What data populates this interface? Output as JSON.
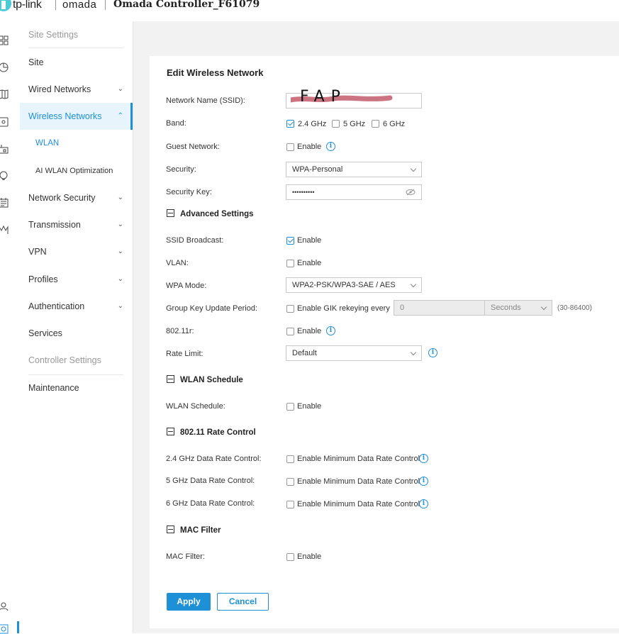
{
  "header": {
    "brand": "tp-link",
    "product": "omada",
    "controller_title": "Omada Controller_F61079"
  },
  "sidebar": {
    "site_settings_header": "Site Settings",
    "items": [
      {
        "label": "Site"
      },
      {
        "label": "Wired Networks"
      },
      {
        "label": "Wireless Networks"
      },
      {
        "label": "WLAN"
      },
      {
        "label": "AI WLAN Optimization"
      },
      {
        "label": "Network Security"
      },
      {
        "label": "Transmission"
      },
      {
        "label": "VPN"
      },
      {
        "label": "Profiles"
      },
      {
        "label": "Authentication"
      },
      {
        "label": "Services"
      }
    ],
    "controller_settings_header": "Controller Settings",
    "maintenance": "Maintenance"
  },
  "form": {
    "title": "Edit Wireless Network",
    "ssid_label": "Network Name (SSID):",
    "ssid_handwritten": "FAP",
    "band_label": "Band:",
    "band_24": "2.4 GHz",
    "band_5": "5 GHz",
    "band_6": "6 GHz",
    "guest_label": "Guest Network:",
    "enable": "Enable",
    "security_label": "Security:",
    "security_value": "WPA-Personal",
    "security_key_label": "Security Key:",
    "security_key_value": "••••••••••",
    "advanced_section": "Advanced Settings",
    "ssid_broadcast_label": "SSID Broadcast:",
    "vlan_label": "VLAN:",
    "wpa_mode_label": "WPA Mode:",
    "wpa_mode_value": "WPA2-PSK/WPA3-SAE / AES",
    "gk_label": "Group Key Update Period:",
    "gk_enable": "Enable GIK rekeying every",
    "gk_value": "0",
    "gk_unit": "Seconds",
    "gk_range": "(30-86400)",
    "r80211_label": "802.11r:",
    "rate_limit_label": "Rate Limit:",
    "rate_limit_value": "Default",
    "schedule_section": "WLAN Schedule",
    "schedule_label": "WLAN Schedule:",
    "rate_control_section": "802.11 Rate Control",
    "rc24_label": "2.4 GHz Data Rate Control:",
    "rc5_label": "5 GHz Data Rate Control:",
    "rc6_label": "6 GHz Data Rate Control:",
    "min_rate": "Enable Minimum Data Rate Control",
    "mac_section": "MAC Filter",
    "mac_label": "MAC Filter:",
    "apply": "Apply",
    "cancel": "Cancel"
  },
  "colors": {
    "accent": "#1e90d6",
    "logo": "#4acbd6"
  }
}
